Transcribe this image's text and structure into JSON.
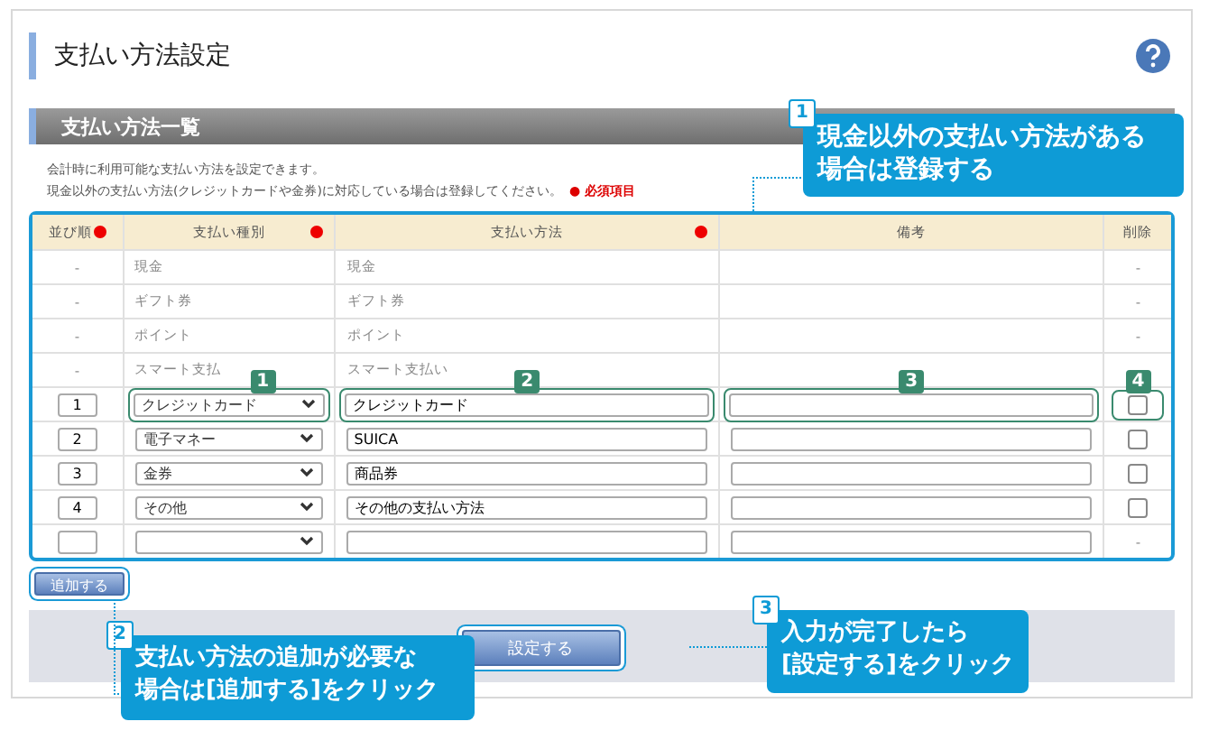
{
  "title": "支払い方法設定",
  "section_title": "支払い方法一覧",
  "description": [
    "会計時に利用可能な支払い方法を設定できます。",
    "現金以外の支払い方法(クレジットカードや金券)に対応している場合は登録してください。"
  ],
  "required_legend": "● 必須項目",
  "table": {
    "columns": [
      {
        "label": "並び順",
        "required": true
      },
      {
        "label": "支払い種別",
        "required": true
      },
      {
        "label": "支払い方法",
        "required": true
      },
      {
        "label": "備考",
        "required": false
      },
      {
        "label": "削除",
        "required": false
      }
    ],
    "rows": [
      {
        "kind": "fixed",
        "order": "-",
        "type": "現金",
        "method": "現金",
        "delete": "-"
      },
      {
        "kind": "fixed",
        "order": "-",
        "type": "ギフト券",
        "method": "ギフト券",
        "delete": "-"
      },
      {
        "kind": "fixed",
        "order": "-",
        "type": "ポイント",
        "method": "ポイント",
        "delete": "-"
      },
      {
        "kind": "fixed",
        "order": "-",
        "type": "スマート支払",
        "method": "スマート支払い"
      },
      {
        "kind": "editable",
        "order": "1",
        "type": "クレジットカード",
        "method": "クレジットカード",
        "checked": false,
        "markers": [
          "1",
          "2",
          "3",
          "4"
        ]
      },
      {
        "kind": "editable",
        "order": "2",
        "type": "電子マネー",
        "method": "SUICA",
        "checked": false
      },
      {
        "kind": "editable",
        "order": "3",
        "type": "金券",
        "method": "商品券",
        "checked": false
      },
      {
        "kind": "editable",
        "order": "4",
        "type": "その他",
        "method": "その他の支払い方法",
        "checked": false
      },
      {
        "kind": "blank",
        "delete": "-"
      }
    ]
  },
  "add_button": "追加する",
  "submit_button": "設定する",
  "callouts": [
    {
      "number": "1",
      "lines": [
        "現金以外の支払い方法がある",
        "場合は登録する"
      ]
    },
    {
      "number": "2",
      "lines": [
        "支払い方法の追加が必要な",
        "場合は[追加する]をクリック"
      ]
    },
    {
      "number": "3",
      "lines": [
        "入力が完了したら",
        "[設定する]をクリック"
      ]
    }
  ]
}
